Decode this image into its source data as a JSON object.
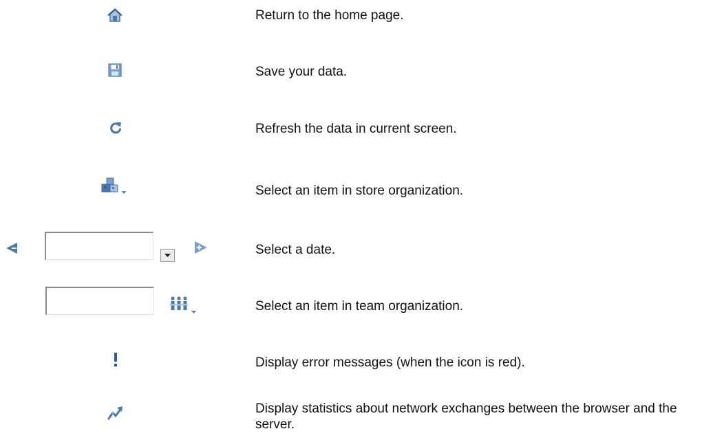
{
  "rows": [
    {
      "icon": "home-icon",
      "text": "Return to the home page."
    },
    {
      "icon": "save-icon",
      "text": "Save your data."
    },
    {
      "icon": "refresh-icon",
      "text": "Refresh the data in current screen."
    },
    {
      "icon": "store-organization-icon",
      "text": "Select an item in store organization."
    },
    {
      "icon": "date-selector",
      "text": "Select a date.",
      "date_value": ""
    },
    {
      "icon": "team-organization-icon",
      "text": "Select an item in team organization.",
      "team_value": ""
    },
    {
      "icon": "error-icon",
      "text": "Display error messages (when the icon is red)."
    },
    {
      "icon": "statistics-icon",
      "text": "Display statistics about network exchanges between the browser and the server."
    }
  ],
  "colors": {
    "icon_blue": "#4f79ad",
    "icon_light_blue": "#a9c3e0",
    "error_blue": "#2a5a94",
    "text": "#111111"
  }
}
